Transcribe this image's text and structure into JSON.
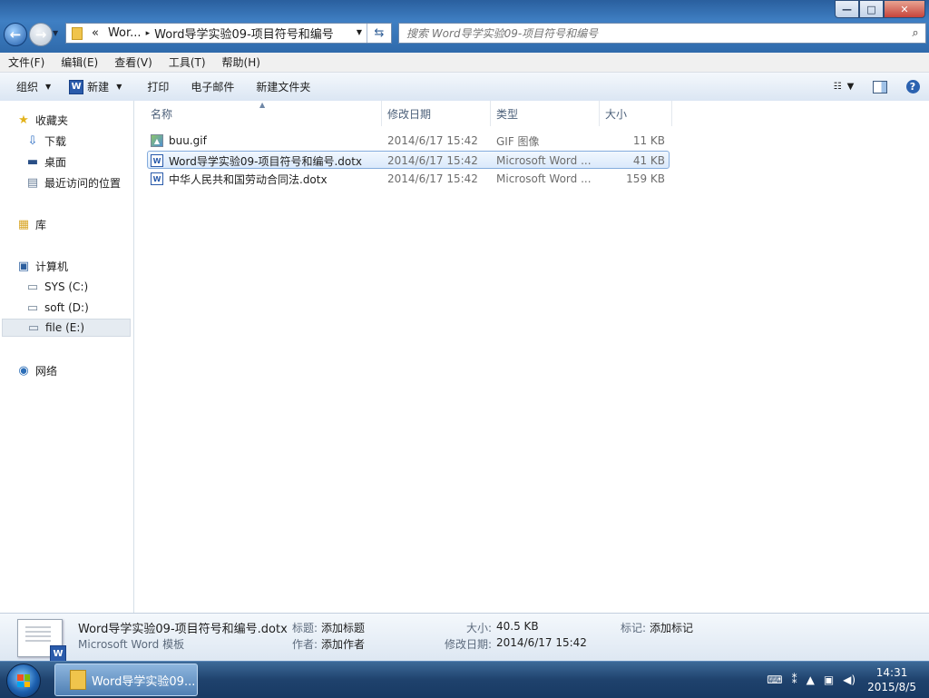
{
  "window": {
    "controls": {
      "minimize": "—",
      "maximize": "□",
      "close": "✕"
    }
  },
  "address_bar": {
    "overflow": "«",
    "crumbs": [
      "Wor...",
      "Word导学实验09-项目符号和编号"
    ],
    "separator": "▸"
  },
  "search": {
    "placeholder": "搜索 Word导学实验09-项目符号和编号"
  },
  "menu": [
    "文件(F)",
    "编辑(E)",
    "查看(V)",
    "工具(T)",
    "帮助(H)"
  ],
  "toolbar": {
    "organize": "组织",
    "new": "新建",
    "print": "打印",
    "email": "电子邮件",
    "new_folder": "新建文件夹",
    "help_glyph": "?"
  },
  "nav": {
    "favorites": {
      "label": "收藏夹",
      "items": [
        "下载",
        "桌面",
        "最近访问的位置"
      ]
    },
    "libraries": "库",
    "computer": {
      "label": "计算机",
      "items": [
        "SYS (C:)",
        "soft (D:)",
        "file (E:)"
      ]
    },
    "network": "网络",
    "selected": "file (E:)"
  },
  "columns": {
    "name": "名称",
    "modified": "修改日期",
    "type": "类型",
    "size": "大小"
  },
  "files": [
    {
      "name": "buu.gif",
      "modified": "2014/6/17 15:42",
      "type": "GIF 图像",
      "size": "11 KB",
      "icon": "gif-image-icon"
    },
    {
      "name": "Word导学实验09-项目符号和编号.dotx",
      "modified": "2014/6/17 15:42",
      "type": "Microsoft Word ...",
      "size": "41 KB",
      "icon": "word-template-icon",
      "selected": true
    },
    {
      "name": "中华人民共和国劳动合同法.dotx",
      "modified": "2014/6/17 15:42",
      "type": "Microsoft Word ...",
      "size": "159 KB",
      "icon": "word-template-icon"
    }
  ],
  "details": {
    "filename": "Word导学实验09-项目符号和编号.dotx",
    "filetype": "Microsoft Word 模板",
    "title_label": "标题:",
    "title_value": "添加标题",
    "author_label": "作者:",
    "author_value": "添加作者",
    "size_label": "大小:",
    "size_value": "40.5 KB",
    "modified_label": "修改日期:",
    "modified_value": "2014/6/17 15:42",
    "tags_label": "标记:",
    "tags_value": "添加标记"
  },
  "taskbar": {
    "item": "Word导学实验09...",
    "time": "14:31",
    "date": "2015/8/5"
  }
}
